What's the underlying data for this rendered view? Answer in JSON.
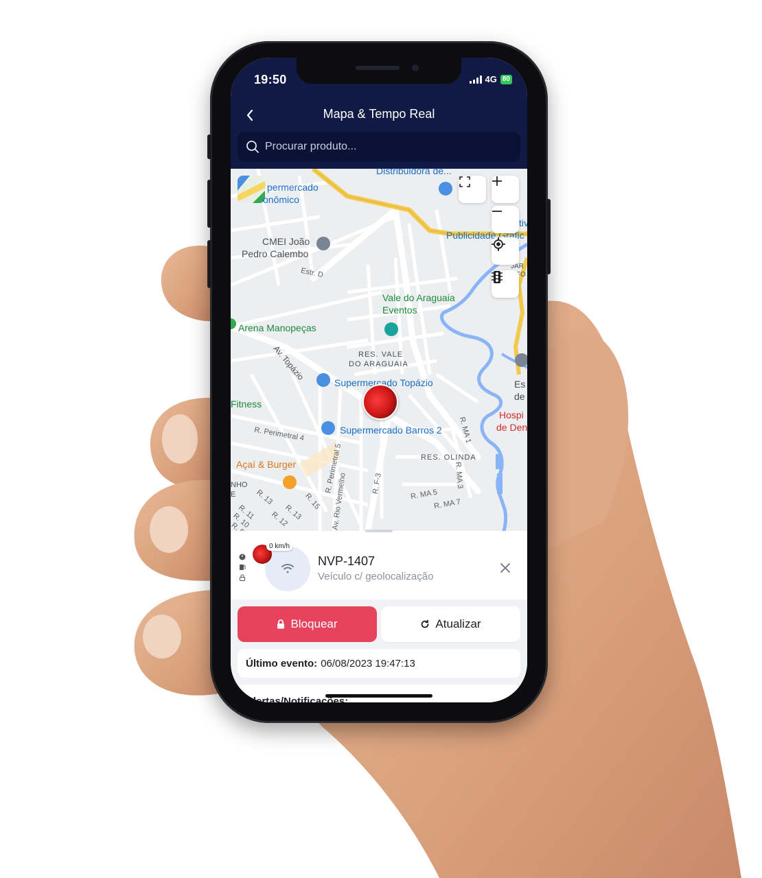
{
  "status_bar": {
    "time": "19:50",
    "network": "4G",
    "battery": "80"
  },
  "header": {
    "title": "Mapa & Tempo Real",
    "back_icon": "chevron-left-icon"
  },
  "search": {
    "placeholder": "Procurar produto...",
    "value": ""
  },
  "map": {
    "labels": {
      "distribuidora": "Distribuidora de...",
      "supermercado_economico_1": "permercado",
      "supermercado_economico_2": "onômico",
      "publicidade": "Publicidade Grafic",
      "cmei_1": "CMEI João",
      "cmei_2": "Pedro Calembo",
      "estr_d": "Estr. D",
      "vale_1": "Vale do Araguaia",
      "vale_2": "Eventos",
      "arena": "Arena Manopeças",
      "res_vale_1": "RES. VALE",
      "res_vale_2": "DO ARAGUAIA",
      "av_topazio": "Av. Topázio",
      "super_topazio": "Supermercado Topázio",
      "fitness": "Fitness",
      "perimetral4": "R. Perimetral 4",
      "super_barros": "Supermercado Barros 2",
      "acai": "Açaí & Burger",
      "res_olinda": "RES. OLINDA",
      "hospital_1": "Hospi",
      "hospital_2": "de Den",
      "escola_1": "Es",
      "escola_2": "de",
      "ma1": "R. MA 1",
      "ma3": "R. MA 3",
      "ma5": "R. MA 5",
      "ma7": "R. MA 7",
      "rf3": "R. F-3",
      "perimetral5": "R. Perimetral 5",
      "rio_vermelho": "Av. Rio Vermelho",
      "r13": "R. 13",
      "r15": "R. 15",
      "r11": "R. 11",
      "r10": "R. 10",
      "r12": "R. 12",
      "r13b": "R. 13",
      "r9": "R. 9",
      "nho": "NHO",
      "e": "E",
      "jar": "JAR",
      "fo": "FO",
      "ativ": "tiv"
    },
    "controls": {
      "fullscreen_icon": "fullscreen-icon",
      "zoom_in_icon": "plus-icon",
      "zoom_out_icon": "minus-icon",
      "locate_icon": "crosshair-icon",
      "traffic_icon": "traffic-light-icon"
    }
  },
  "vehicle": {
    "speed": "0 km/h",
    "plate": "NVP-1407",
    "subtitle": "Veículo c/ geolocalização"
  },
  "actions": {
    "block_label": "Bloquear",
    "refresh_label": "Atualizar"
  },
  "last_event": {
    "label": "Último evento:",
    "value": "06/08/2023 19:47:13"
  },
  "alerts": {
    "title": "Alertas/Notificações:"
  },
  "colors": {
    "header_bg": "#101a45",
    "block_button": "#e8435e",
    "map_bg": "#eceef0",
    "road_main": "#f2c94c"
  }
}
